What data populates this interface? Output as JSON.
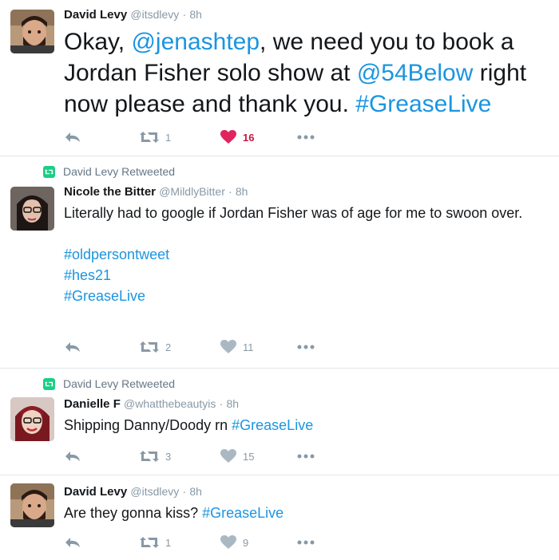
{
  "colors": {
    "link": "#1b95e0",
    "like": "#e0245e",
    "retweet_badge": "#19cf86",
    "muted": "#8899a6"
  },
  "tweets": [
    {
      "retweet_context": null,
      "name": "David Levy",
      "handle": "@itsdlevy",
      "time": "8h",
      "segments": [
        {
          "text": "Okay, "
        },
        {
          "text": "@jenashtep",
          "link": true
        },
        {
          "text": ", we need you to book a Jordan Fisher solo show at "
        },
        {
          "text": "@54Below",
          "link": true
        },
        {
          "text": " right now please and thank you. "
        },
        {
          "text": "#GreaseLive",
          "link": true
        }
      ],
      "retweets": "1",
      "likes": "16",
      "liked": true,
      "avatar_icon": "bearded-man-avatar"
    },
    {
      "retweet_context": "David Levy Retweeted",
      "name": "Nicole the Bitter",
      "handle": "@MildlyBitter",
      "time": "8h",
      "lines": [
        "Literally had to google if Jordan Fisher was of age for me to swoon over."
      ],
      "hashtags": [
        "#oldpersontweet",
        "#hes21",
        "#GreaseLive"
      ],
      "retweets": "2",
      "likes": "11",
      "liked": false,
      "avatar_icon": "woman-glasses-avatar"
    },
    {
      "retweet_context": "David Levy Retweeted",
      "name": "Danielle F",
      "handle": "@whatthebeautyis",
      "time": "8h",
      "segments": [
        {
          "text": "Shipping Danny/Doody rn "
        },
        {
          "text": "#GreaseLive",
          "link": true
        }
      ],
      "retweets": "3",
      "likes": "15",
      "liked": false,
      "avatar_icon": "woman-red-hair-avatar"
    },
    {
      "retweet_context": null,
      "name": "David Levy",
      "handle": "@itsdlevy",
      "time": "8h",
      "segments": [
        {
          "text": "Are they gonna kiss? "
        },
        {
          "text": "#GreaseLive",
          "link": true
        }
      ],
      "retweets": "1",
      "likes": "9",
      "liked": false,
      "avatar_icon": "bearded-man-avatar"
    }
  ],
  "separators": {
    "dot": "·"
  }
}
